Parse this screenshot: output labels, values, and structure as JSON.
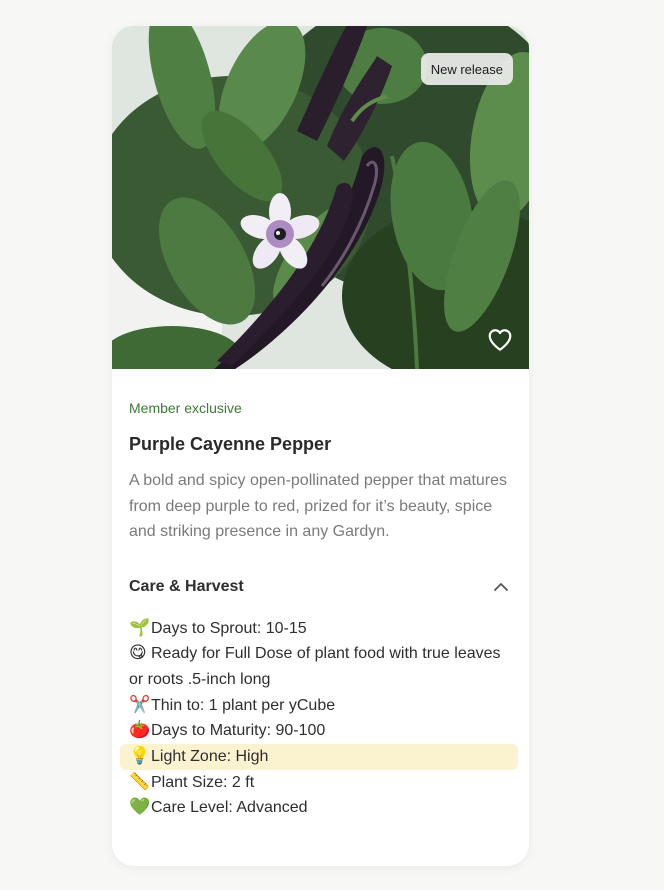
{
  "hero": {
    "badge": "New release",
    "heart_icon": "heart-outline-icon"
  },
  "product": {
    "eyebrow": "Member exclusive",
    "title": "Purple Cayenne Pepper",
    "description": "A bold and spicy open-pollinated pepper that matures from deep purple to red, prized for it’s beauty, spice and striking presence in any Gardyn."
  },
  "care": {
    "heading": "Care & Harvest",
    "toggle_icon": "chevron-up-icon",
    "items": [
      {
        "icon": "🌱",
        "icon_name": "seedling-icon",
        "text": "Days to Sprout: 10-15",
        "highlight": false
      },
      {
        "icon": "😋",
        "icon_name": "yum-face-icon",
        "text": "Ready for Full Dose of plant food with true leaves or roots .5-inch long",
        "highlight": false
      },
      {
        "icon": "✂️",
        "icon_name": "scissors-icon",
        "text": "Thin to: 1 plant per yCube",
        "highlight": false
      },
      {
        "icon": "🍅",
        "icon_name": "tomato-icon",
        "text": "Days to Maturity: 90-100",
        "highlight": false
      },
      {
        "icon": "💡",
        "icon_name": "light-bulb-icon",
        "text": "Light Zone: High",
        "highlight": true
      },
      {
        "icon": "📏",
        "icon_name": "ruler-icon",
        "text": "Plant Size: 2 ft",
        "highlight": false
      },
      {
        "icon": "💚",
        "icon_name": "green-heart-icon",
        "text": "Care Level: Advanced",
        "highlight": false
      }
    ]
  },
  "colors": {
    "accent_green": "#3d7a35",
    "highlight": "#fbf2cf",
    "muted_text": "#7a7a7a"
  }
}
